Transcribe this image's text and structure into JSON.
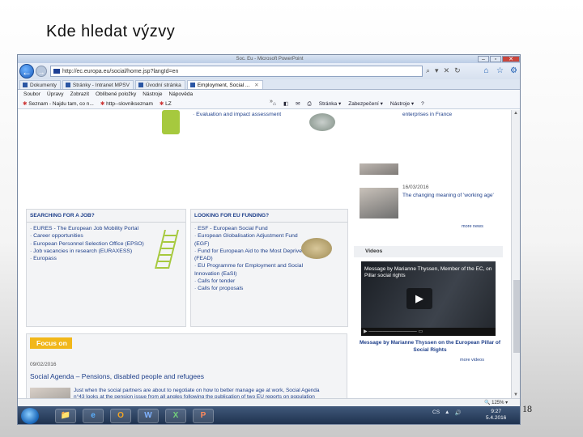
{
  "slide": {
    "title": "Kde  hledat výzvy",
    "number": "18"
  },
  "window": {
    "title": "Soc. Eu - Microsoft PowerPoint",
    "buttons": [
      "–",
      "▫",
      "✕"
    ]
  },
  "address": {
    "url": "http://ec.europa.eu/social/home.jsp?langId=en",
    "tools": [
      "⌕",
      "▾",
      "✕",
      "↻"
    ]
  },
  "tabs": [
    {
      "label": "Dokumenty"
    },
    {
      "label": "Stránky - Intranet MPSV"
    },
    {
      "label": "Úvodní stránka"
    },
    {
      "label": "Employment, Social ...",
      "active": true,
      "close": "✕"
    }
  ],
  "menu": [
    "Soubor",
    "Úpravy",
    "Zobrazit",
    "Oblíbené položky",
    "Nástroje",
    "Nápověda"
  ],
  "favorites": {
    "left": [
      "Seznam - Najdu tam, co n...",
      "http--slovnikseznam",
      "LZ"
    ],
    "chevron": "»",
    "right": [
      "Stránka ▾",
      "Zabezpečení ▾",
      "Nástroje ▾",
      "?"
    ]
  },
  "page": {
    "top_evaluation": "· Evaluation and impact assessment",
    "france_text": "enterprises in France",
    "news_date": "16/03/2016",
    "news_text": "The changing meaning of 'working age'",
    "more_news": "more news",
    "job_panel": {
      "heading": "SEARCHING FOR A JOB?",
      "items": [
        "· EURES - The European Job Mobility Portal",
        "· Career opportunities",
        "· European Personnel Selection Office (EPSO)",
        "· Job vacancies in research (EURAXESS)",
        "· Europass"
      ]
    },
    "funding_panel": {
      "heading": "LOOKING FOR EU FUNDING?",
      "items": [
        "· ESF - European Social Fund",
        "· European Globalisation Adjustment Fund",
        "  (EGF)",
        "· Fund for European Aid to the Most Deprived",
        "  (FEAD)",
        "· EU Programme for Employment and Social",
        "  Innovation (EaSI)",
        "· Calls for tender",
        "· Calls for proposals"
      ]
    },
    "videos": {
      "heading": "Videos",
      "video_title": "Message by Marianne Thyssen, Member of the EC, on Pillar social rights",
      "caption": "Message by Marianne Thyssen on the European Pillar of Social Rights",
      "more": "more videos"
    },
    "focus": {
      "badge": "Focus on",
      "date": "09/02/2016",
      "title": "Social Agenda – Pensions, disabled people and refugees",
      "body": "Just when the social partners are about to negotiate on how to better manage age at work, Social Agenda n°43 looks at the pension issue from all angles following the publication of two EU reports on population ageing and on pension adequacy"
    }
  },
  "status": {
    "zoom": "🔍 125%  ▾"
  },
  "taskbar": {
    "items": [
      "📁",
      "e",
      "O",
      "W",
      "X",
      "P"
    ],
    "tray": [
      "CS",
      "▲",
      "🔊"
    ],
    "time": "9:27",
    "date": "5.4.2016"
  }
}
